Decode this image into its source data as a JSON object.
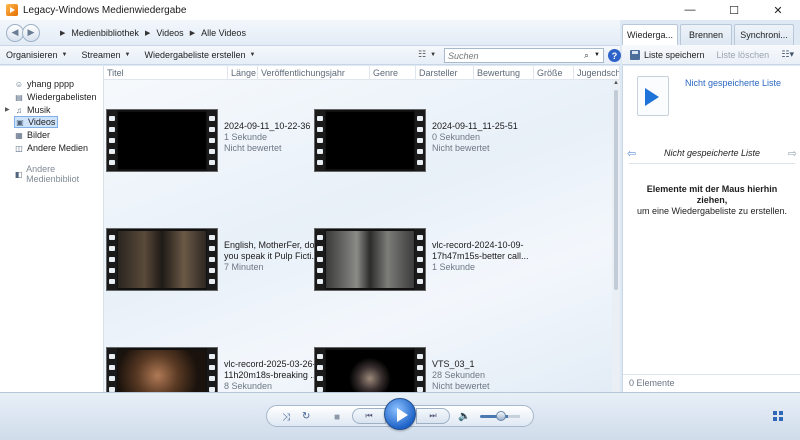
{
  "window": {
    "title": "Legacy-Windows Medienwiedergabe",
    "minimize": "—",
    "maximize": "☐",
    "close": "✕"
  },
  "breadcrumb": [
    "Medienbibliothek",
    "Videos",
    "Alle Videos"
  ],
  "toolbar": {
    "organize": "Organisieren",
    "stream": "Streamen",
    "create_playlist": "Wiedergabeliste erstellen",
    "search_placeholder": "Suchen"
  },
  "tabs": [
    "Wiederga...",
    "Brennen",
    "Synchroni..."
  ],
  "right_toolbar": {
    "save_list": "Liste speichern",
    "clear_list": "Liste löschen"
  },
  "nav_tree": [
    {
      "label": "yhang pppp",
      "icon": "user-icon"
    },
    {
      "label": "Wiedergabelisten",
      "icon": "playlist-icon"
    },
    {
      "label": "Musik",
      "icon": "music-icon"
    },
    {
      "label": "Videos",
      "icon": "video-icon",
      "selected": true
    },
    {
      "label": "Bilder",
      "icon": "picture-icon"
    },
    {
      "label": "Andere Medien",
      "icon": "other-media-icon"
    },
    {
      "label": "Andere Medienbibliot",
      "icon": "other-library-icon"
    }
  ],
  "columns": [
    "Titel",
    "Länge",
    "Veröffentlichungsjahr",
    "Genre",
    "Darsteller",
    "Bewertung",
    "Größe",
    "Jugendschut"
  ],
  "videos": [
    {
      "title": "2024-09-11_10-22-36",
      "title2": "",
      "duration": "1 Sekunde",
      "rating": "Nicht bewertet"
    },
    {
      "title": "2024-09-11_11-25-51",
      "title2": "",
      "duration": "0 Sekunden",
      "rating": "Nicht bewertet"
    },
    {
      "title": "English, MotherFer, do",
      "title2": "you speak it  Pulp Ficti...",
      "duration": "7 Minuten",
      "rating": ""
    },
    {
      "title": "vlc-record-2024-10-09-",
      "title2": "17h47m15s-better call...",
      "duration": "1 Sekunde",
      "rating": ""
    },
    {
      "title": "vlc-record-2025-03-26-",
      "title2": "11h20m18s-breaking ...",
      "duration": "8 Sekunden",
      "rating": ""
    },
    {
      "title": "VTS_03_1",
      "title2": "",
      "duration": "28 Sekunden",
      "rating": "Nicht bewertet"
    }
  ],
  "right_pane": {
    "unsaved_link": "Nicht gespeicherte Liste",
    "nav_title": "Nicht gespeicherte Liste",
    "drag_bold": "Elemente mit der Maus hierhin ziehen,",
    "drag_rest": "um eine Wiedergabeliste zu erstellen.",
    "count": "0 Elemente"
  },
  "player": {
    "shuffle": "⤨",
    "repeat": "↻",
    "stop": "■",
    "prev": "⏮",
    "next": "⏭",
    "volume": "🔈",
    "volume_level": 0.65
  }
}
